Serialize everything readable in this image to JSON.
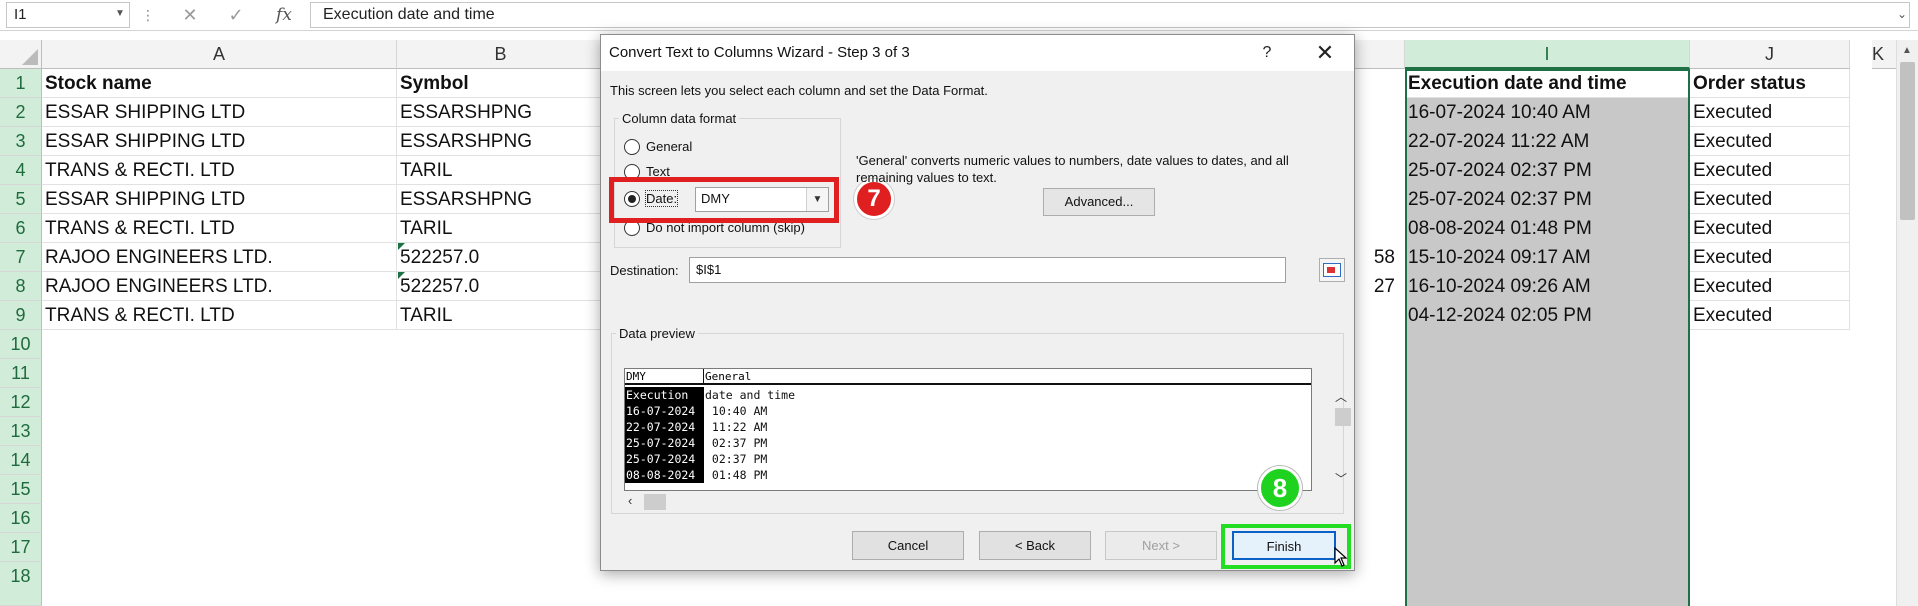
{
  "formula_bar": {
    "name_box": "I1",
    "formula": "Execution date and time",
    "cancel_icon": "close-icon",
    "enter_icon": "check-icon",
    "fx_label": "fx"
  },
  "columns": {
    "A": "A",
    "B": "B",
    "I": "I",
    "J": "J",
    "K": "K"
  },
  "rows": [
    "1",
    "2",
    "3",
    "4",
    "5",
    "6",
    "7",
    "8",
    "9",
    "10",
    "11",
    "12",
    "13",
    "14",
    "15",
    "16",
    "17",
    "18"
  ],
  "sheet": {
    "headers": {
      "stock_name": "Stock name",
      "symbol": "Symbol",
      "exec_date": "Execution date and time",
      "order_status": "Order status"
    },
    "records": [
      {
        "stock": "ESSAR SHIPPING LTD",
        "symbol": "ESSARSHPNG",
        "date": "16-07-2024 10:40 AM",
        "status": "Executed"
      },
      {
        "stock": "ESSAR SHIPPING LTD",
        "symbol": "ESSARSHPNG",
        "date": "22-07-2024 11:22 AM",
        "status": "Executed"
      },
      {
        "stock": "TRANS & RECTI. LTD",
        "symbol": "TARIL",
        "date": "25-07-2024 02:37 PM",
        "status": "Executed"
      },
      {
        "stock": "ESSAR SHIPPING LTD",
        "symbol": "ESSARSHPNG",
        "date": "25-07-2024 02:37 PM",
        "status": "Executed"
      },
      {
        "stock": "TRANS & RECTI. LTD",
        "symbol": "TARIL",
        "date": "08-08-2024 01:48 PM",
        "status": "Executed"
      },
      {
        "stock": "RAJOO ENGINEERS LTD.",
        "symbol": "522257.0",
        "date": "15-10-2024 09:17 AM",
        "status": "Executed"
      },
      {
        "stock": "RAJOO ENGINEERS LTD.",
        "symbol": "522257.0",
        "date": "16-10-2024 09:26 AM",
        "status": "Executed"
      },
      {
        "stock": "TRANS & RECTI. LTD",
        "symbol": "TARIL",
        "date": "04-12-2024 02:05 PM",
        "status": "Executed"
      }
    ],
    "obscured_fragments": {
      "row7": "58",
      "row8": "27"
    }
  },
  "dialog": {
    "title": "Convert Text to Columns Wizard - Step 3 of 3",
    "help": "?",
    "close": "✕",
    "description": "This screen lets you select each column and set the Data Format.",
    "format_group_title": "Column data format",
    "options": {
      "general": "General",
      "text": "Text",
      "date": "Date:",
      "skip": "Do not import column (skip)"
    },
    "selected_option": "date",
    "date_format": "DMY",
    "general_note": "'General' converts numeric values to numbers, date values to dates, and all remaining values to text.",
    "advanced_button": "Advanced...",
    "destination_label": "Destination:",
    "destination_value": "$I$1",
    "preview_title": "Data preview",
    "preview": {
      "col1_header": "DMY",
      "col2_header": "General",
      "rows": [
        {
          "c1": "Execution",
          "c2": "date and time"
        },
        {
          "c1": "16-07-2024",
          "c2": " 10:40 AM"
        },
        {
          "c1": "22-07-2024",
          "c2": " 11:22 AM"
        },
        {
          "c1": "25-07-2024",
          "c2": " 02:37 PM"
        },
        {
          "c1": "25-07-2024",
          "c2": " 02:37 PM"
        },
        {
          "c1": "08-08-2024",
          "c2": " 01:48 PM"
        }
      ]
    },
    "buttons": {
      "cancel": "Cancel",
      "back": "< Back",
      "next": "Next >",
      "finish": "Finish"
    }
  },
  "annotations": {
    "step_7": "7",
    "step_8": "8",
    "step_7_color": "#e02020",
    "step_8_color": "#1fd21f"
  },
  "colors": {
    "excel_green": "#1e7145",
    "selected_header_bg": "#d2ecda",
    "selected_column_fill": "#c8c8c8"
  }
}
